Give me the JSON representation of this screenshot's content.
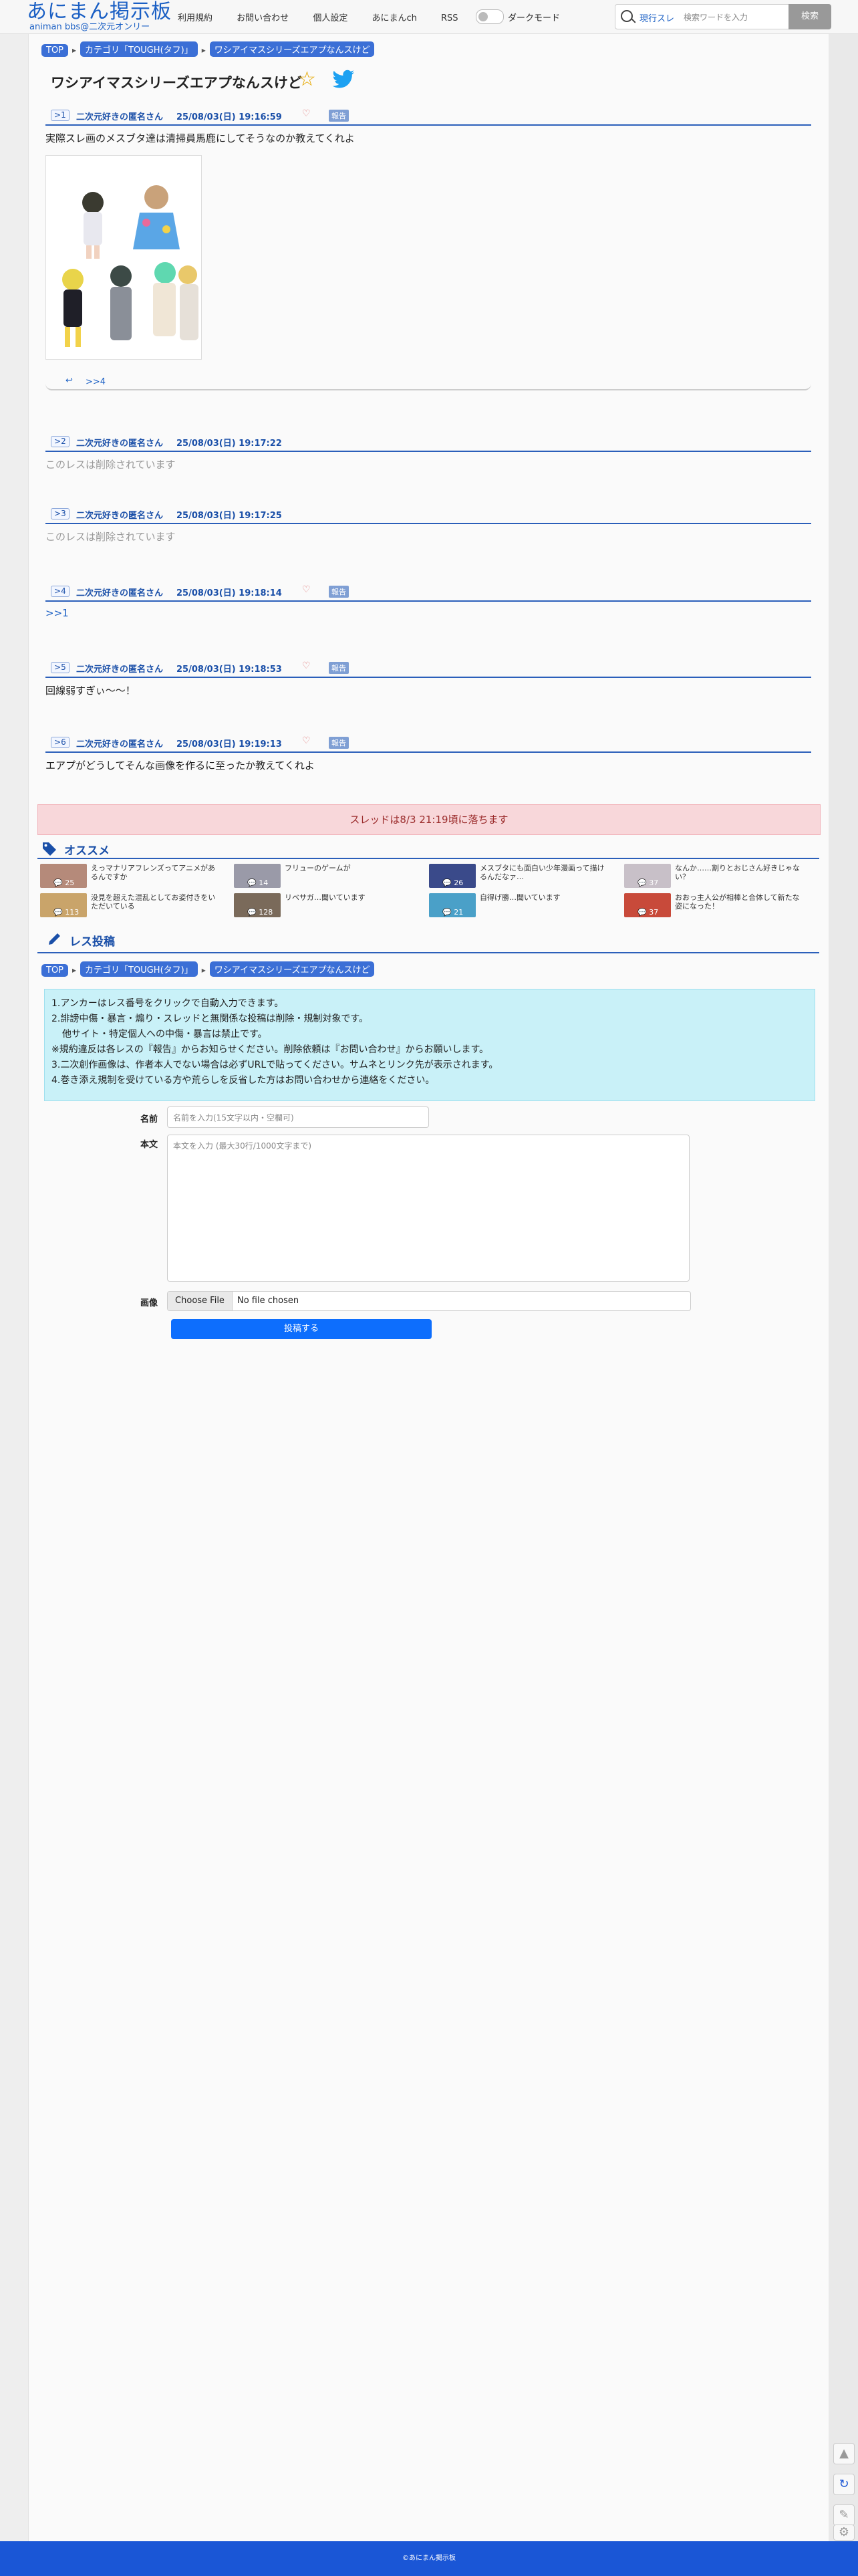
{
  "header": {
    "logo": "あにまん掲示板",
    "logo_sub": "animan bbs@二次元オンリー",
    "nav": [
      "利用規約",
      "お問い合わせ",
      "個人設定",
      "あにまんch",
      "RSS"
    ],
    "dark_mode_label": "ダークモード",
    "search_scope": "現行スレ",
    "search_placeholder": "検索ワードを入力",
    "search_button": "検索"
  },
  "breadcrumb": [
    "TOP",
    "カテゴリ「TOUGH(タフ)」",
    "ワシアイマスシリーズエアプなんスけど"
  ],
  "thread": {
    "title": "ワシアイマスシリーズエアプなんスけど"
  },
  "posts": [
    {
      "num": "1",
      "name": "二次元好きの匿名さん",
      "date": "25/08/03(日) 19:16:59",
      "report": "報告",
      "body": "実際スレ画のメスブタ達は清掃員馬鹿にしてそうなのか教えてくれよ",
      "reply": ">>4"
    },
    {
      "num": "2",
      "name": "二次元好きの匿名さん",
      "date": "25/08/03(日) 19:17:22",
      "body": "このレスは削除されています"
    },
    {
      "num": "3",
      "name": "二次元好きの匿名さん",
      "date": "25/08/03(日) 19:17:25",
      "body": "このレスは削除されています"
    },
    {
      "num": "4",
      "name": "二次元好きの匿名さん",
      "date": "25/08/03(日) 19:18:14",
      "report": "報告",
      "body": ">>1"
    },
    {
      "num": "5",
      "name": "二次元好きの匿名さん",
      "date": "25/08/03(日) 19:18:53",
      "report": "報告",
      "body": "回線弱すぎぃ〜〜！"
    },
    {
      "num": "6",
      "name": "二次元好きの匿名さん",
      "date": "25/08/03(日) 19:19:13",
      "report": "報告",
      "body": "エアプがどうしてそんな画像を作るに至ったか教えてくれよ"
    }
  ],
  "notice": "スレッドは8/3 21:19頃に落ちます",
  "recommend": {
    "title": "オススメ",
    "items": [
      {
        "text": "えっマナリアフレンズってアニメがあるんですか",
        "count": "25",
        "color": "#b58a7a"
      },
      {
        "text": "フリューのゲームが",
        "count": "14",
        "color": "#9a9aa8"
      },
      {
        "text": "メスブタにも面白い少年漫画って描けるんだなァ…",
        "count": "26",
        "color": "#3a4a8a"
      },
      {
        "text": "なんか……割りとおじさん好きじゃない？",
        "count": "37",
        "color": "#c8c0c8"
      },
      {
        "text": "没見を超えた混乱としてお姿付きをいただいている",
        "count": "113",
        "color": "#c9a46a"
      },
      {
        "text": "リベサガ…聞いています",
        "count": "128",
        "color": "#7a6a5a"
      },
      {
        "text": "自得げ勝…聞いています",
        "count": "21",
        "color": "#4aa0c8"
      },
      {
        "text": "おおっ主人公が相棒と合体して新たな姿になった！",
        "count": "37",
        "color": "#c84a3a"
      }
    ]
  },
  "reply_form": {
    "title": "レス投稿",
    "rules": [
      "1.アンカーはレス番号をクリックで自動入力できます。",
      "2.誹謗中傷・暴言・煽り・スレッドと無関係な投稿は削除・規制対象です。",
      "他サイト・特定個人への中傷・暴言は禁止です。",
      "※規約違反は各レスの『報告』からお知らせください。削除依頼は『お問い合わせ』からお願いします。",
      "3.二次創作画像は、作者本人でない場合は必ずURLで貼ってください。サムネとリンク先が表示されます。",
      "4.巻き添え規制を受けている方や荒らしを反省した方はお問い合わせから連絡をください。"
    ],
    "name_label": "名前",
    "name_placeholder": "名前を入力(15文字以内・空欄可)",
    "body_label": "本文",
    "body_placeholder": "本文を入力 (最大30行/1000文字まで)",
    "image_label": "画像",
    "file_button": "Choose File",
    "file_status": "No file chosen",
    "submit": "投稿する"
  },
  "footer": "©あにまん掲示板",
  "colors": {
    "brand": "#1a56d6",
    "accent": "#2b5fba",
    "notice_bg": "#f8d7da",
    "rules_bg": "#c9f1f8"
  }
}
